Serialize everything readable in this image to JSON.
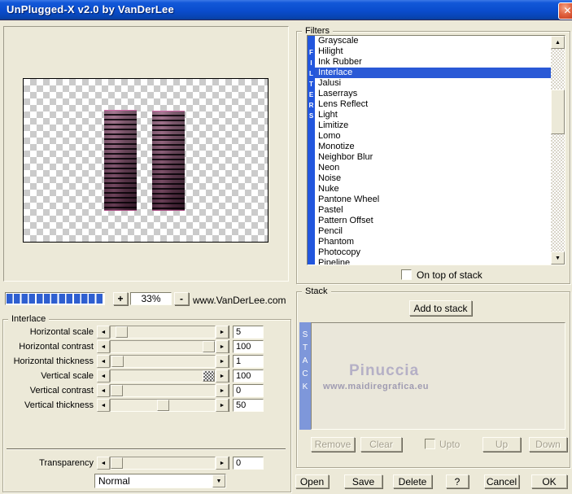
{
  "window": {
    "title": "UnPlugged-X v2.0 by VanDerLee",
    "close": "✕"
  },
  "preview": {
    "zoom_in": "+",
    "zoom_level": "33%",
    "zoom_out": "-",
    "website": "www.VanDerLee.com"
  },
  "interlace": {
    "title": "Interlace",
    "sliders": [
      {
        "label": "Horizontal scale",
        "value": "5",
        "pos": 5
      },
      {
        "label": "Horizontal contrast",
        "value": "100",
        "pos": 100
      },
      {
        "label": "Horizontal thickness",
        "value": "1",
        "pos": 1
      },
      {
        "label": "Vertical scale",
        "value": "100",
        "pos": 100
      },
      {
        "label": "Vertical contrast",
        "value": "0",
        "pos": 0
      },
      {
        "label": "Vertical thickness",
        "value": "50",
        "pos": 50
      }
    ],
    "transparency": {
      "label": "Transparency",
      "value": "0",
      "pos": 0
    },
    "blend_mode": "Normal"
  },
  "filters": {
    "title": "Filters",
    "side_label": "FILTERS",
    "items": [
      "Grayscale",
      "Hilight",
      "Ink Rubber",
      "Interlace",
      "Jalusi",
      "Laserrays",
      "Lens Reflect",
      "Light",
      "Limitize",
      "Lomo",
      "Monotize",
      "Neighbor Blur",
      "Neon",
      "Noise",
      "Nuke",
      "Pantone Wheel",
      "Pastel",
      "Pattern Offset",
      "Pencil",
      "Phantom",
      "Photocopy",
      "Pipeline"
    ],
    "selected": "Interlace",
    "on_top_label": "On top of stack"
  },
  "stack": {
    "title": "Stack",
    "add_button": "Add to stack",
    "side_label": "STACK",
    "watermark_name": "Pinuccia",
    "watermark_site": "www.maidiregrafica.eu",
    "remove_button": "Remove",
    "clear_button": "Clear",
    "upto_label": "Upto",
    "up_button": "Up",
    "down_button": "Down"
  },
  "footer": {
    "open": "Open",
    "save": "Save",
    "delete": "Delete",
    "help": "?",
    "cancel": "Cancel",
    "ok": "OK"
  },
  "colors": {
    "titlebar_blue": "#0a4ccd",
    "dialog_bg": "#ece9d8",
    "selection_blue": "#2a59d6",
    "filters_bar_blue": "#2256dd",
    "stack_bar_blue": "#7e97da",
    "close_red": "#c33b1e",
    "segment_blue": "#2e5fd0",
    "column_purple": "#5d2f49"
  }
}
